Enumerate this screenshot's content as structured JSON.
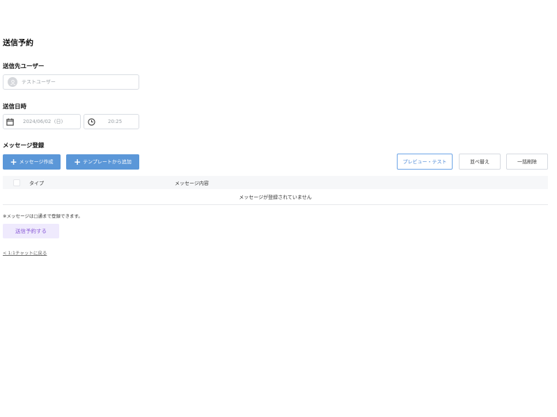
{
  "page": {
    "title": "送信予約"
  },
  "recipient": {
    "label": "送信先ユーザー",
    "value": "テストユーザー"
  },
  "datetime": {
    "label": "送信日時",
    "date_value": "2024/06/02  (日)",
    "time_value": "20:25"
  },
  "messages": {
    "label": "メッセージ登録",
    "create_button": "メッセージ作成",
    "template_button": "テンプレートから追加",
    "preview_button": "プレビュー・テスト",
    "sort_button": "並べ替え",
    "bulk_delete_button": "一括削除",
    "table": {
      "col_type": "タイプ",
      "col_content": "メッセージ内容",
      "empty_text": "メッセージが登録されていません"
    },
    "note": "※メッセージは□通まで登録できます。"
  },
  "actions": {
    "submit_label": "送信予約する",
    "back_link": "< 1:1チャットに戻る"
  },
  "colors": {
    "primary": "#5b97d8",
    "submit_bg": "#efeafd",
    "submit_text": "#8a5bd6"
  }
}
